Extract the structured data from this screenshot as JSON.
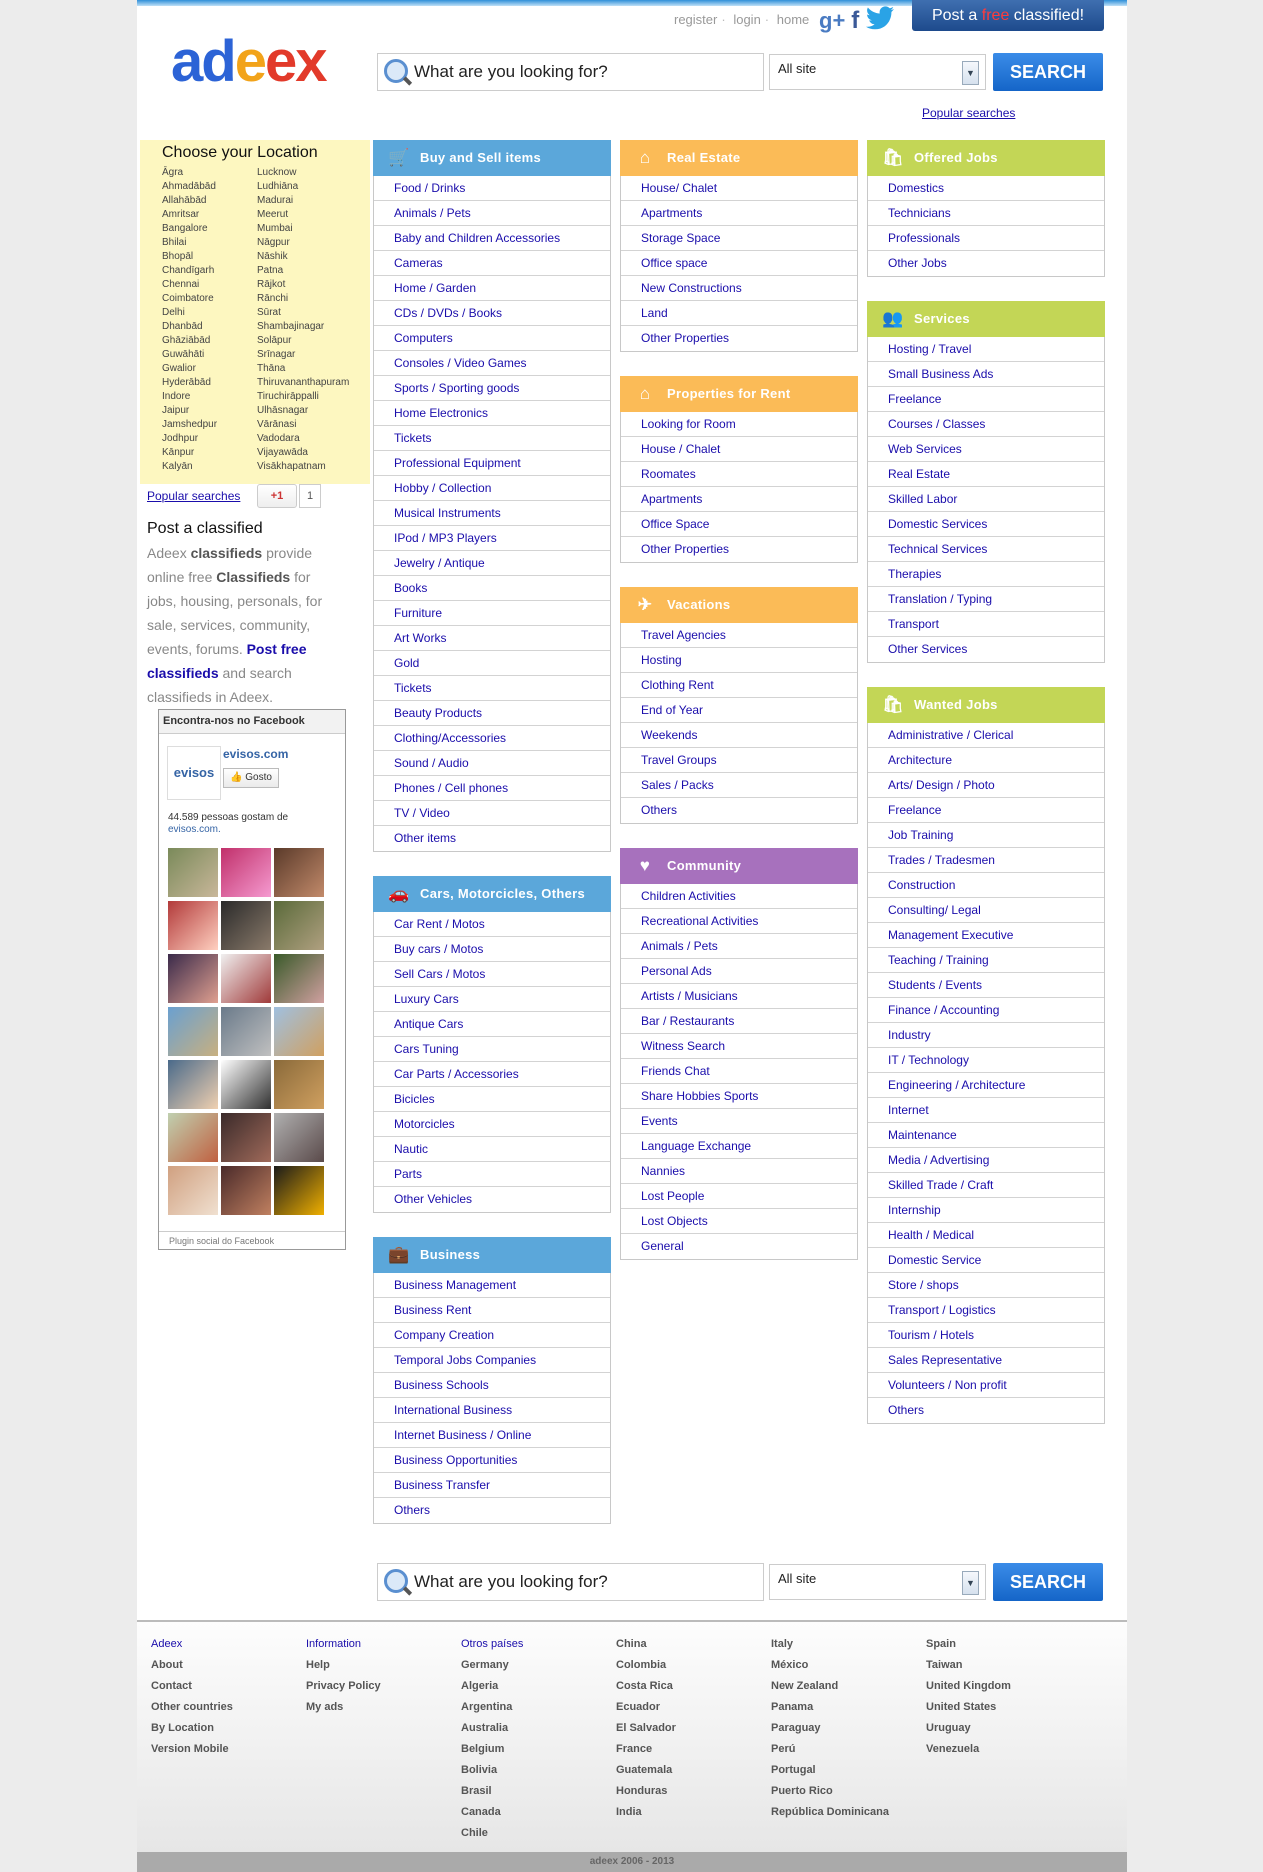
{
  "header": {
    "links": [
      "register",
      "login",
      "home"
    ],
    "post_button": {
      "prefix": "Post a ",
      "free": "free",
      "suffix": " classified!"
    },
    "logo": {
      "l1": "ad",
      "l2": "e",
      "l3": "ex"
    },
    "search": {
      "placeholder": "What are you looking for?",
      "select": "All site",
      "button": "SEARCH"
    },
    "popular": "Popular searches"
  },
  "location": {
    "title": "Choose your Location",
    "col1": [
      "Āgra",
      "Ahmadābād",
      "Allahābād",
      "Amritsar",
      "Bangalore",
      "Bhilai",
      "Bhopāl",
      "Chandīgarh",
      "Chennai",
      "Coimbatore",
      "Delhi",
      "Dhanbād",
      "Ghāziābād",
      "Guwāhāti",
      "Gwalior",
      "Hyderābād",
      "Indore",
      "Jaipur",
      "Jamshedpur",
      "Jodhpur",
      "Kānpur",
      "Kalyān"
    ],
    "col2": [
      "Lucknow",
      "Ludhiāna",
      "Madurai",
      "Meerut",
      "Mumbai",
      "Nāgpur",
      "Nāshik",
      "Patna",
      "Rājkot",
      "Rānchi",
      "Sūrat",
      "Shambajinagar",
      "Solāpur",
      "Srīnagar",
      "Thāna",
      "Thiruvananthapuram",
      "Tiruchirāppalli",
      "Ulhāsnagar",
      "Vārānasi",
      "Vadodara",
      "Vijayawāda",
      "Visākhapatnam"
    ]
  },
  "sidebar": {
    "popular": "Popular searches",
    "gplus": "+1",
    "gplus_count": "1",
    "post_title": "Post a classified",
    "desc": {
      "a": "Adeex ",
      "b": "classifieds",
      "c": " provide online free ",
      "d": "Classifieds",
      "e": " for jobs, housing, personals, for sale, services, community, events, forums. ",
      "link": "Post free classifieds",
      "f": " and search classifieds in Adeex."
    },
    "facebook": {
      "header": "Encontra-nos no Facebook",
      "logo": "evisos",
      "page": "evisos.com",
      "like": "Gosto",
      "count": "44.589 pessoas gostam de",
      "count_link": "evisos.com.",
      "footer": "Plugin social do Facebook"
    }
  },
  "panels": {
    "buy": {
      "title": "Buy and Sell items",
      "icon": "cart-icon",
      "color": "blue",
      "items": [
        "Food / Drinks",
        "Animals / Pets",
        "Baby and Children Accessories",
        "Cameras",
        "Home / Garden",
        "CDs / DVDs / Books",
        "Computers",
        "Consoles / Video Games",
        "Sports / Sporting goods",
        "Home Electronics",
        "Tickets",
        "Professional Equipment",
        "Hobby / Collection",
        "Musical Instruments",
        "IPod / MP3 Players",
        "Jewelry / Antique",
        "Books",
        "Furniture",
        "Art Works",
        "Gold",
        "Tickets",
        "Beauty Products",
        "Clothing/Accessories",
        "Sound / Audio",
        "Phones / Cell phones",
        "TV / Video",
        "Other items"
      ]
    },
    "cars": {
      "title": "Cars, Motorcicles, Others",
      "icon": "car-icon",
      "color": "blue",
      "items": [
        "Car Rent / Motos",
        "Buy cars / Motos",
        "Sell Cars / Motos",
        "Luxury Cars",
        "Antique Cars",
        "Cars Tuning",
        "Car Parts / Accessories",
        "Bicicles",
        "Motorcicles",
        "Nautic",
        "Parts",
        "Other Vehicles"
      ]
    },
    "business": {
      "title": "Business",
      "icon": "briefcase-icon",
      "color": "blue",
      "items": [
        "Business Management",
        "Business Rent",
        "Company Creation",
        "Temporal Jobs Companies",
        "Business Schools",
        "International Business",
        "Internet Business / Online",
        "Business Opportunities",
        "Business Transfer",
        "Others"
      ]
    },
    "realestate": {
      "title": "Real Estate",
      "icon": "house-icon",
      "color": "orange",
      "items": [
        "House/ Chalet",
        "Apartments",
        "Storage Space",
        "Office space",
        "New Constructions",
        "Land",
        "Other Properties"
      ]
    },
    "rent": {
      "title": "Properties for Rent",
      "icon": "house-icon",
      "color": "orange",
      "items": [
        "Looking for Room",
        "House / Chalet",
        "Roomates",
        "Apartments",
        "Office Space",
        "Other Properties"
      ]
    },
    "vacations": {
      "title": "Vacations",
      "icon": "plane-icon",
      "color": "orange",
      "items": [
        "Travel Agencies",
        "Hosting",
        "Clothing Rent",
        "End of Year",
        "Weekends",
        "Travel Groups",
        "Sales / Packs",
        "Others"
      ]
    },
    "community": {
      "title": "Community",
      "icon": "heart-icon",
      "color": "purple",
      "items": [
        "Children Activities",
        "Recreational Activities",
        "Animals / Pets",
        "Personal Ads",
        "Artists / Musicians",
        "Bar / Restaurants",
        "Witness Search",
        "Friends Chat",
        "Share Hobbies Sports",
        "Events",
        "Language Exchange",
        "Nannies",
        "Lost People",
        "Lost Objects",
        "General"
      ]
    },
    "jobs": {
      "title": "Offered Jobs",
      "icon": "bag-icon",
      "color": "green",
      "items": [
        "Domestics",
        "Technicians",
        "Professionals",
        "Other Jobs"
      ]
    },
    "services": {
      "title": "Services",
      "icon": "people-icon",
      "color": "green",
      "items": [
        "Hosting / Travel",
        "Small Business Ads",
        "Freelance",
        "Courses / Classes",
        "Web Services",
        "Real Estate",
        "Skilled Labor",
        "Domestic Services",
        "Technical Services",
        "Therapies",
        "Translation / Typing",
        "Transport",
        "Other Services"
      ]
    },
    "wanted": {
      "title": "Wanted Jobs",
      "icon": "bag-icon",
      "color": "green",
      "items": [
        "Administrative / Clerical",
        "Architecture",
        "Arts/ Design / Photo",
        "Freelance",
        "Job Training",
        "Trades / Tradesmen",
        "Construction",
        "Consulting/ Legal",
        "Management Executive",
        "Teaching / Training",
        "Students / Events",
        "Finance / Accounting",
        "Industry",
        "IT / Technology",
        "Engineering / Architecture",
        "Internet",
        "Maintenance",
        "Media / Advertising",
        "Skilled Trade / Craft",
        "Internship",
        "Health / Medical",
        "Domestic Service",
        "Store / shops",
        "Transport / Logistics",
        "Tourism / Hotels",
        "Sales Representative",
        "Volunteers / Non profit",
        "Others"
      ]
    }
  },
  "footer": {
    "adeex": {
      "h": "Adeex",
      "items": [
        "About",
        "Contact",
        "Other countries",
        "By Location",
        "Version Mobile"
      ]
    },
    "info": {
      "h": "Information",
      "items": [
        "Help",
        "Privacy Policy",
        "My ads"
      ]
    },
    "countries": {
      "h": "Otros países",
      "items": [
        "Germany",
        "Algeria",
        "Argentina",
        "Australia",
        "Belgium",
        "Bolivia",
        "Brasil",
        "Canada",
        "Chile"
      ]
    },
    "c2": [
      "China",
      "Colombia",
      "Costa Rica",
      "Ecuador",
      "El Salvador",
      "France",
      "Guatemala",
      "Honduras",
      "India"
    ],
    "c3": [
      "Italy",
      "México",
      "New Zealand",
      "Panama",
      "Paraguay",
      "Perú",
      "Portugal",
      "Puerto Rico",
      "República Dominicana"
    ],
    "c4": [
      "Spain",
      "Taiwan",
      "United Kingdom",
      "United States",
      "Uruguay",
      "Venezuela"
    ],
    "copyright": "adeex 2006 - 2013"
  },
  "colors": {
    "blue": "#5ba7da",
    "orange": "#fbbb57",
    "green": "#c3d656",
    "purple": "#a771bd",
    "link": "#1a0dab"
  }
}
